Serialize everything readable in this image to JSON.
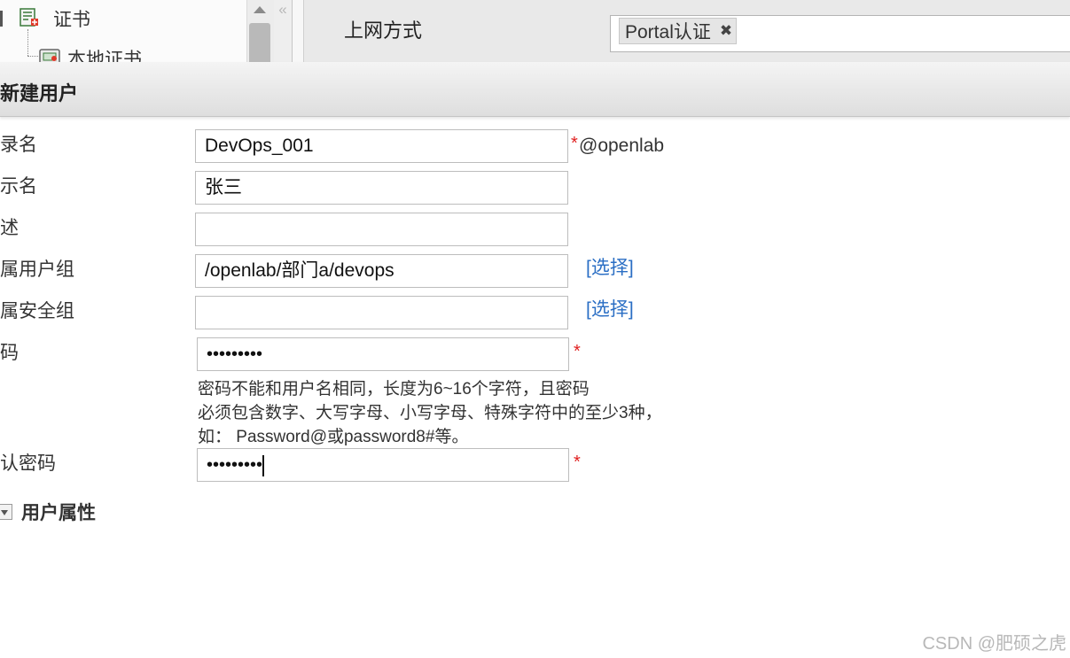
{
  "background": {
    "tree": {
      "item_certificate": "证书",
      "item_local_certificate": "本地证书"
    },
    "collapse_glyph": "«",
    "access_method_label": "上网方式",
    "portal_tag": "Portal认证",
    "tag_remove_glyph": "✖"
  },
  "dialog": {
    "title": "新建用户",
    "labels": {
      "login_name": "录名",
      "display_name": "示名",
      "description": "述",
      "user_group": "属用户组",
      "security_group": "属安全组",
      "password": "码",
      "confirm_password": "认密码"
    },
    "values": {
      "login_name": "DevOps_001",
      "display_name": "张三",
      "description": "",
      "user_group": "/openlab/部门a/devops",
      "security_group": "",
      "password_mask": "•••••••••",
      "confirm_password_mask": "•••••••••"
    },
    "domain_suffix": "@openlab",
    "required_mark": "*",
    "select_link": "[选择]",
    "password_hint": [
      "密码不能和用户名相同，长度为6~16个字符，且密码",
      "必须包含数字、大写字母、小写字母、特殊字符中的至少3种，",
      "如： Password@或password8#等。"
    ],
    "section_user_attributes": "用户属性"
  },
  "watermark": "CSDN @肥硕之虎",
  "colors": {
    "required": "#e02020",
    "link": "#2a6ec4"
  }
}
